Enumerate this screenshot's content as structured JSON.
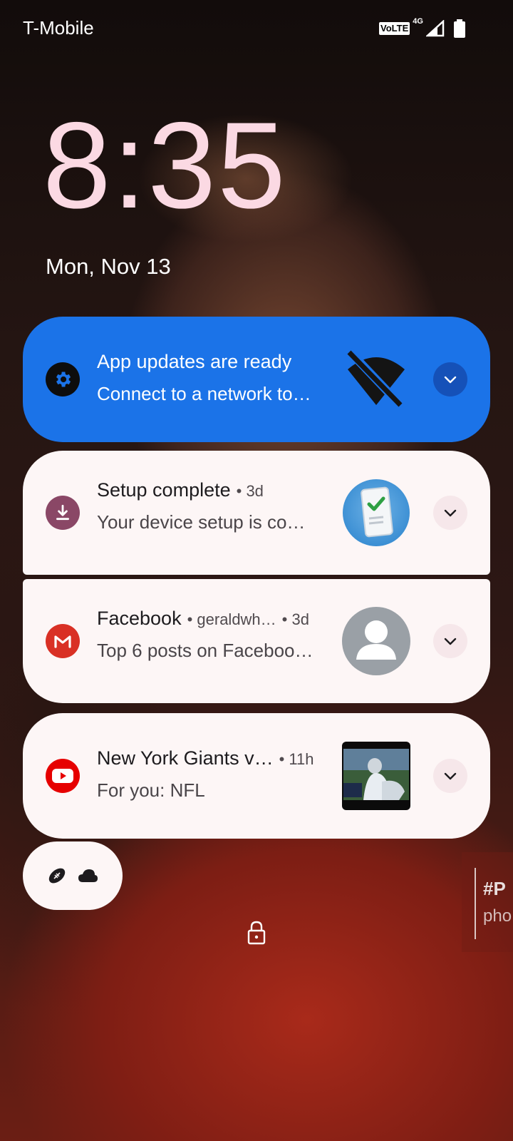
{
  "status_bar": {
    "carrier": "T-Mobile",
    "volte_label": "VoLTE",
    "network_label": "4G"
  },
  "lockscreen": {
    "time": "8:35",
    "date": "Mon, Nov 13"
  },
  "notifications": [
    {
      "app_icon": "gear-icon",
      "title": "App updates are ready",
      "meta": "",
      "body": "Connect to a network to…",
      "thumbnail": "wifi-off-icon",
      "accent": "#1b73e8"
    },
    {
      "app_icon": "download-icon",
      "title": "Setup complete",
      "meta": "• 3d",
      "body": "Your device setup is co…",
      "thumbnail": "phone-check-icon",
      "accent": "#8a4766"
    },
    {
      "app_icon": "gmail-icon",
      "title": "Facebook",
      "meta_sender": "• geraldwh…",
      "meta": "• 3d",
      "body": "Top 6 posts on Faceboo…",
      "thumbnail": "person-avatar-icon",
      "accent": "#d93025"
    },
    {
      "app_icon": "youtube-icon",
      "title": "New York Giants v…",
      "meta": "• 11h",
      "body": "For you: NFL",
      "thumbnail": "nfl-video-thumbnail",
      "accent": "#e60000"
    }
  ],
  "shortcuts": [
    "football-icon",
    "cloud-icon"
  ],
  "wallpaper_watermark": {
    "line1": "#P",
    "line2": "pho"
  },
  "lock_icon": "padlock-icon"
}
